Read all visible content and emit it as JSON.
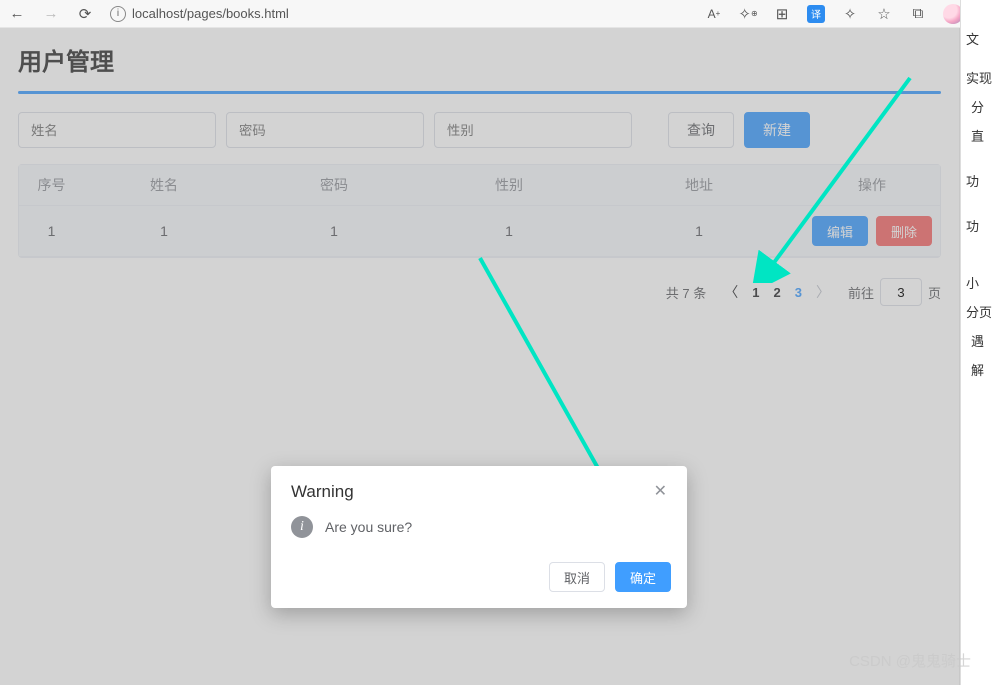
{
  "browser": {
    "url": "localhost/pages/books.html",
    "zoom_label": "A",
    "menu_dots": "···"
  },
  "page": {
    "title": "用户管理"
  },
  "search": {
    "name_ph": "姓名",
    "pass_ph": "密码",
    "sex_ph": "性别",
    "query_btn": "查询",
    "new_btn": "新建"
  },
  "table": {
    "headers": {
      "index": "序号",
      "name": "姓名",
      "pass": "密码",
      "sex": "性别",
      "addr": "地址",
      "op": "操作"
    },
    "rows": [
      {
        "index": "1",
        "name": "1",
        "pass": "1",
        "sex": "1",
        "addr": "1"
      }
    ],
    "edit_btn": "编辑",
    "del_btn": "删除"
  },
  "pagination": {
    "total_text": "共 7 条",
    "pages": [
      "1",
      "2",
      "3"
    ],
    "active_index": 2,
    "goto_prefix": "前往",
    "goto_value": "3",
    "goto_suffix": "页"
  },
  "dialog": {
    "title": "Warning",
    "message": "Are you sure?",
    "cancel": "取消",
    "confirm": "确定"
  },
  "rightpanel": {
    "items": [
      "文",
      "实现",
      "分",
      "直",
      "功",
      "功",
      "小",
      "分页",
      "遇",
      "解"
    ]
  },
  "watermark": "CSDN @鬼鬼骑士"
}
